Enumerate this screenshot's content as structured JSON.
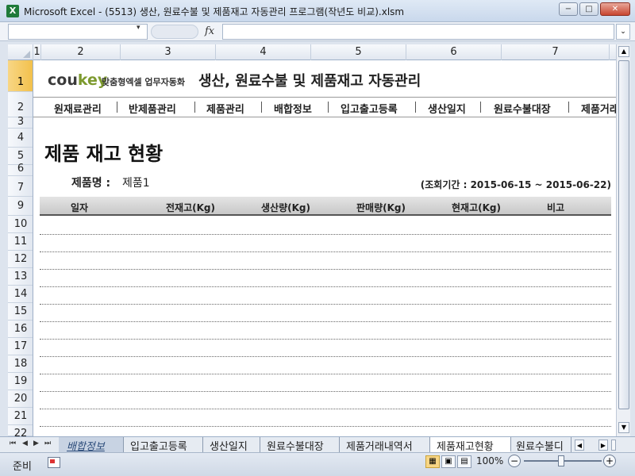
{
  "window": {
    "title": "Microsoft Excel - (5513) 생산, 원료수불 및 제품재고 자동관리 프로그램(작년도 비교).xlsm",
    "app_icon": "X",
    "minimize_icon": "−",
    "maximize_icon": "□",
    "close_icon": "✕"
  },
  "formula_bar": {
    "name_box": "",
    "formula": "",
    "fx_label": "fx",
    "dropdown_icon": "▾",
    "expand_icon": "⌄"
  },
  "columns": [
    "1",
    "2",
    "3",
    "4",
    "5",
    "6",
    "7"
  ],
  "rows": [
    "1",
    "2",
    "3",
    "4",
    "5",
    "6",
    "7",
    "9",
    "10",
    "11",
    "12",
    "13",
    "14",
    "15",
    "16",
    "17",
    "18",
    "19",
    "20",
    "21",
    "22"
  ],
  "brand": {
    "logo_main": "cou",
    "logo_accent": "key",
    "tagline": "맞춤형엑셀 업무자동화",
    "heading": "생산, 원료수불 및 제품재고 자동관리"
  },
  "nav": [
    "원재료관리",
    "반제품관리",
    "제품관리",
    "배합정보",
    "입고출고등록",
    "생산일지",
    "원료수불대장",
    "제품거래"
  ],
  "report": {
    "title": "제품 재고 현황",
    "product_label": "제품명 :",
    "product_value": "제품1",
    "period": "(조회기간 : 2015-06-15 ~ 2015-06-22)"
  },
  "table": {
    "headers": [
      "일자",
      "전재고(Kg)",
      "생산량(Kg)",
      "판매량(Kg)",
      "현재고(Kg)",
      "비고"
    ],
    "empty_rows": 12
  },
  "sheet_tabs": [
    {
      "label": "배합정보",
      "state": "partial"
    },
    {
      "label": "입고출고등록",
      "state": "normal"
    },
    {
      "label": "생산일지",
      "state": "normal"
    },
    {
      "label": "원료수불대장",
      "state": "normal"
    },
    {
      "label": "제품거래내역서",
      "state": "normal"
    },
    {
      "label": "제품재고현황",
      "state": "active"
    },
    {
      "label": "원료수불디",
      "state": "normal"
    }
  ],
  "tab_nav": [
    "⏮",
    "◀",
    "▶",
    "⏭"
  ],
  "status": {
    "ready": "준비",
    "zoom": "100%",
    "zoom_out": "−",
    "zoom_in": "+",
    "view_icons": [
      "▦",
      "▣",
      "▤"
    ]
  }
}
